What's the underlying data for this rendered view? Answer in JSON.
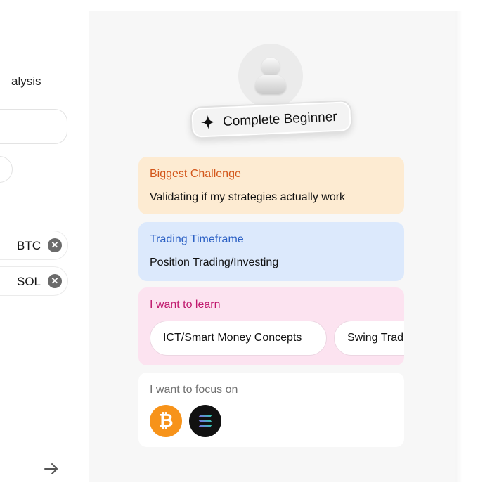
{
  "left_panel": {
    "title": "alysis",
    "chips": [
      {
        "label": "BTC",
        "remove_icon": "close-circle-icon"
      },
      {
        "label": "SOL",
        "remove_icon": "close-circle-icon"
      }
    ],
    "next_icon": "arrow-right-icon"
  },
  "profile": {
    "avatar_icon": "user-avatar-icon",
    "level_label": "Complete Beginner",
    "level_icon": "sparkle-icon"
  },
  "cards": {
    "challenge": {
      "title": "Biggest Challenge",
      "value": "Validating if my strategies actually work",
      "title_color": "#d3561a",
      "bg_color": "#fdebd2"
    },
    "timeframe": {
      "title": "Trading Timeframe",
      "value": "Position Trading/Investing",
      "title_color": "#2a5fc4",
      "bg_color": "#dce9fc"
    },
    "learn": {
      "title": "I want to learn",
      "items": [
        "ICT/Smart Money Concepts",
        "Swing Trading"
      ],
      "title_color": "#c0186d",
      "bg_color": "#fce3f0"
    },
    "focus": {
      "title": "I want to focus on",
      "coins": [
        {
          "name": "bitcoin-icon",
          "glyph": "₿",
          "color": "#f7931a"
        },
        {
          "name": "solana-icon",
          "color": "#111111"
        }
      ]
    }
  }
}
